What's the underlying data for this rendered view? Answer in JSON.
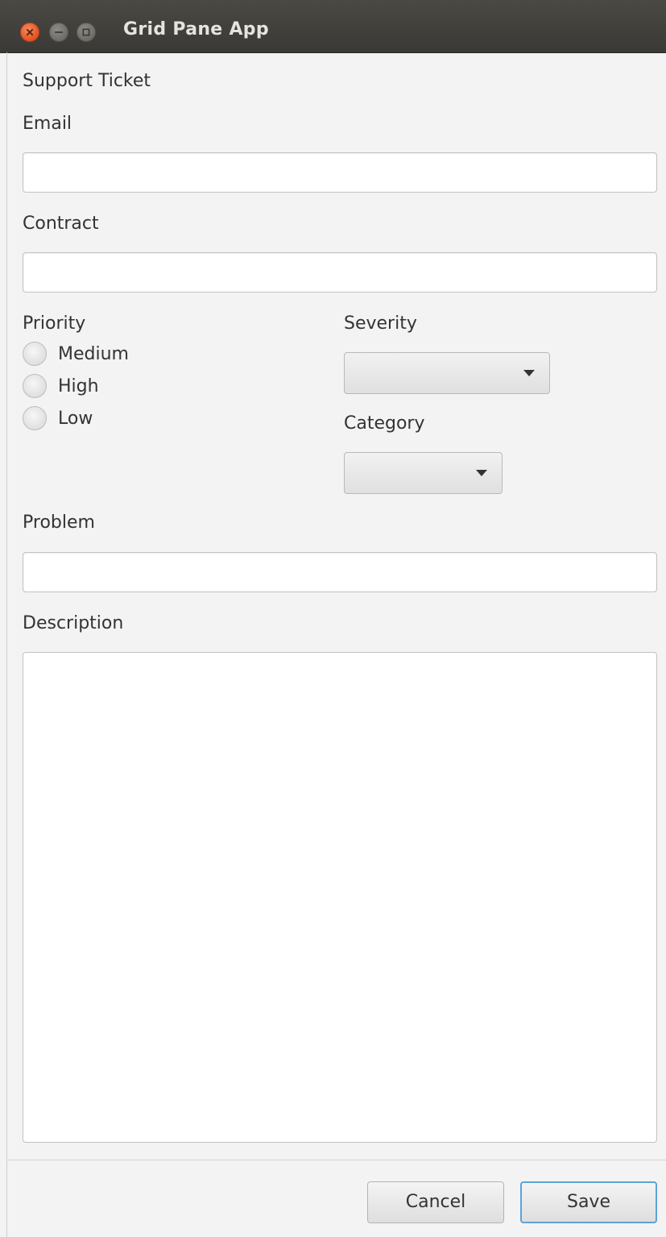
{
  "window": {
    "title": "Grid Pane App"
  },
  "form": {
    "heading": "Support Ticket",
    "email": {
      "label": "Email",
      "value": ""
    },
    "contract": {
      "label": "Contract",
      "value": ""
    },
    "priority": {
      "label": "Priority",
      "options": [
        {
          "label": "Medium",
          "selected": false
        },
        {
          "label": "High",
          "selected": false
        },
        {
          "label": "Low",
          "selected": false
        }
      ]
    },
    "severity": {
      "label": "Severity",
      "value": ""
    },
    "category": {
      "label": "Category",
      "value": ""
    },
    "problem": {
      "label": "Problem",
      "value": ""
    },
    "description": {
      "label": "Description",
      "value": ""
    }
  },
  "buttons": {
    "cancel": "Cancel",
    "save": "Save"
  },
  "icons": {
    "close": "close-icon",
    "minimize": "minimize-icon",
    "maximize": "maximize-icon",
    "dropdown": "chevron-down-icon"
  },
  "colors": {
    "titlebar": "#3f3e3a",
    "close_button": "#e95420",
    "focus_border": "#5ea3d6",
    "background": "#f3f3f3"
  }
}
